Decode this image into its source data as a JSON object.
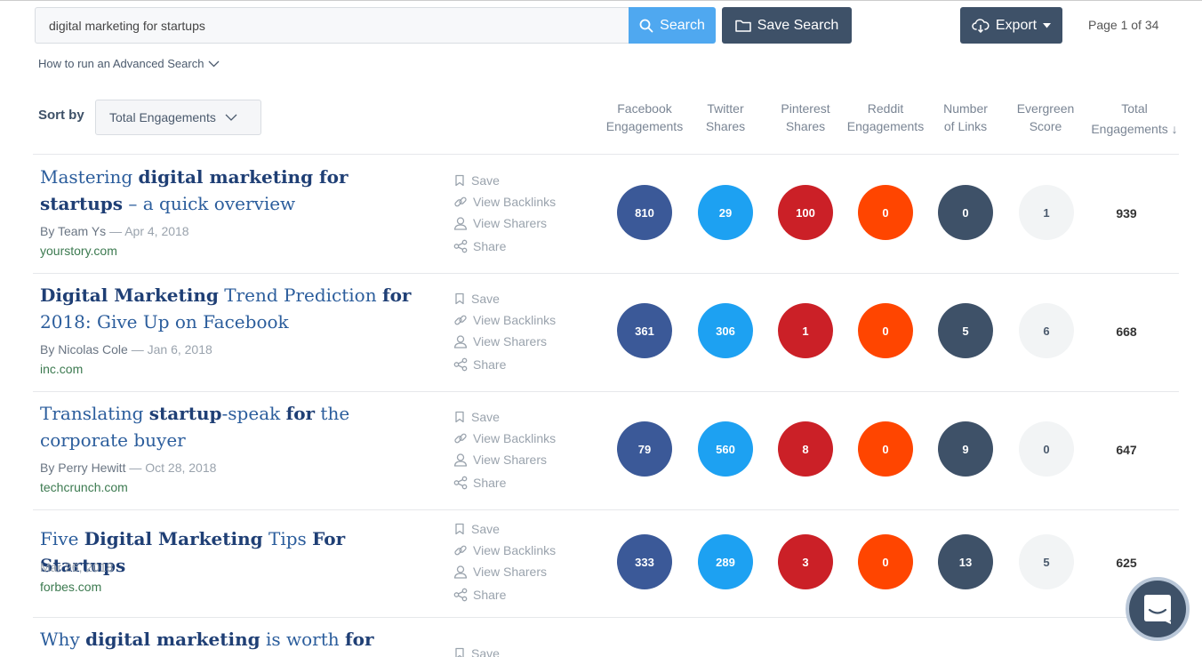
{
  "search": {
    "query": "digital marketing for startups",
    "button_label": "Search"
  },
  "toolbar": {
    "save_search_label": "Save Search",
    "export_label": "Export"
  },
  "pagination": {
    "label": "Page 1 of 34"
  },
  "advanced_search": {
    "label": "How to run an Advanced Search"
  },
  "sort": {
    "label": "Sort by",
    "selected": "Total Engagements"
  },
  "columns": [
    {
      "line1": "Facebook",
      "line2": "Engagements"
    },
    {
      "line1": "Twitter",
      "line2": "Shares"
    },
    {
      "line1": "Pinterest",
      "line2": "Shares"
    },
    {
      "line1": "Reddit",
      "line2": "Engagements"
    },
    {
      "line1": "Number",
      "line2": "of Links"
    },
    {
      "line1": "Evergreen",
      "line2": "Score"
    },
    {
      "line1": "Total",
      "line2": "Engagements",
      "arrow": "↓"
    }
  ],
  "action_labels": {
    "save": "Save",
    "backlinks": "View Backlinks",
    "sharers": "View Sharers",
    "share": "Share"
  },
  "colors": {
    "facebook": "#3b5998",
    "twitter": "#1da1f2",
    "pinterest": "#cb2027",
    "reddit": "#ff4500",
    "links": "#3e5168",
    "evergreen": "#f2f4f5",
    "search_button": "#4fa8f0",
    "dark_button": "#3e5168"
  },
  "articles": [
    {
      "title_parts": [
        {
          "text": "Mastering ",
          "bold": false
        },
        {
          "text": "digital marketing for startups",
          "bold": true
        },
        {
          "text": " – a quick overview",
          "bold": false
        }
      ],
      "author": "By Team Ys",
      "date": "Apr 4, 2018",
      "domain": "yourstory.com",
      "facebook": "810",
      "twitter": "29",
      "pinterest": "100",
      "reddit": "0",
      "links": "0",
      "evergreen": "1",
      "total": "939"
    },
    {
      "title_parts": [
        {
          "text": "Digital Marketing",
          "bold": true
        },
        {
          "text": " Trend Prediction ",
          "bold": false
        },
        {
          "text": "for",
          "bold": true
        },
        {
          "text": " 2018: Give Up on Facebook",
          "bold": false
        }
      ],
      "author": "By Nicolas Cole",
      "date": "Jan 6, 2018",
      "domain": "inc.com",
      "facebook": "361",
      "twitter": "306",
      "pinterest": "1",
      "reddit": "0",
      "links": "5",
      "evergreen": "6",
      "total": "668"
    },
    {
      "title_parts": [
        {
          "text": "Translating ",
          "bold": false
        },
        {
          "text": "startup",
          "bold": true
        },
        {
          "text": "-speak ",
          "bold": false
        },
        {
          "text": "for",
          "bold": true
        },
        {
          "text": " the corporate buyer",
          "bold": false
        }
      ],
      "author": "By Perry Hewitt",
      "date": "Oct 28, 2018",
      "domain": "techcrunch.com",
      "facebook": "79",
      "twitter": "560",
      "pinterest": "8",
      "reddit": "0",
      "links": "9",
      "evergreen": "0",
      "total": "647"
    },
    {
      "title_parts": [
        {
          "text": "Five ",
          "bold": false
        },
        {
          "text": "Digital Marketing",
          "bold": true
        },
        {
          "text": " Tips ",
          "bold": false
        },
        {
          "text": "For Startups",
          "bold": true
        }
      ],
      "author": "",
      "date": "Mar 26, 2018",
      "domain": "forbes.com",
      "facebook": "333",
      "twitter": "289",
      "pinterest": "3",
      "reddit": "0",
      "links": "13",
      "evergreen": "5",
      "total": "625"
    },
    {
      "title_parts": [
        {
          "text": "Why ",
          "bold": false
        },
        {
          "text": "digital marketing",
          "bold": true
        },
        {
          "text": " is worth ",
          "bold": false
        },
        {
          "text": "for",
          "bold": true
        }
      ],
      "author": "",
      "date": "",
      "domain": "",
      "partial": true
    }
  ]
}
